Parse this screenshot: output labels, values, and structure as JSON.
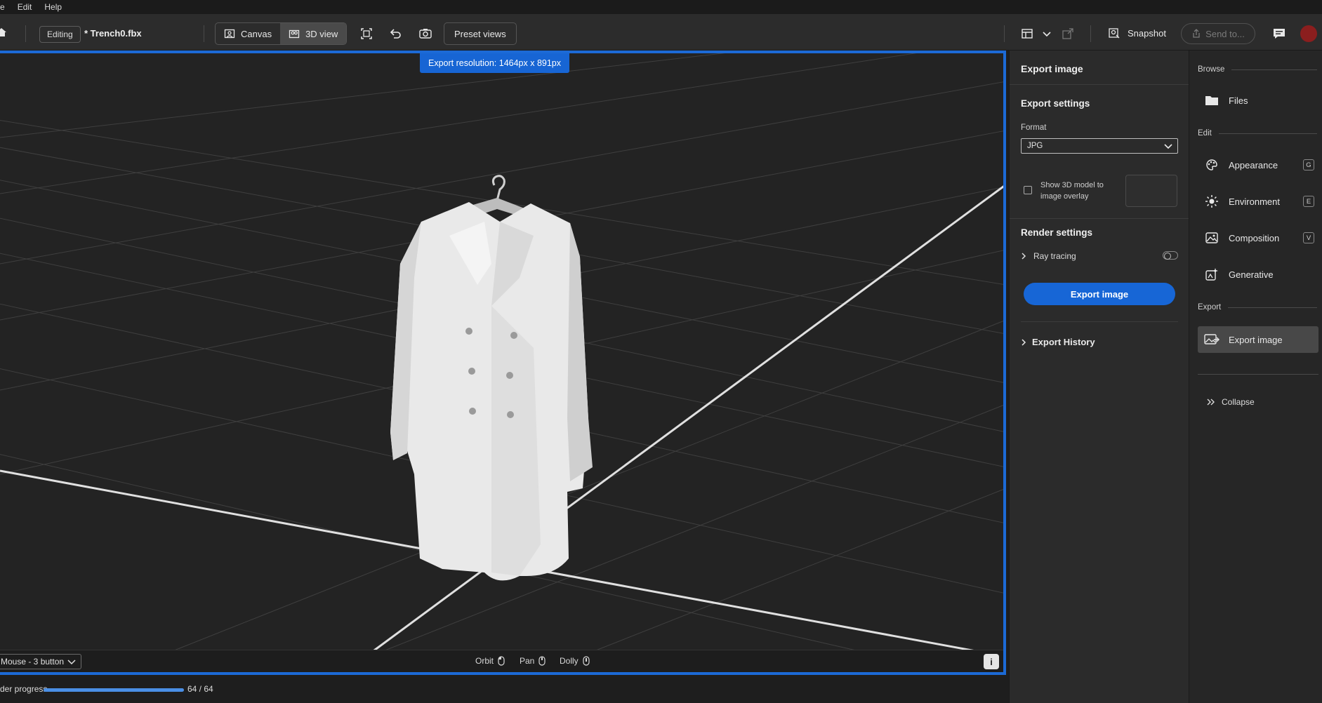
{
  "menu": {
    "items": [
      "e",
      "Edit",
      "Help"
    ]
  },
  "toolbar": {
    "editing_label": "Editing",
    "file_name": "* Trench0.fbx",
    "canvas_label": "Canvas",
    "view3d_label": "3D view",
    "preset_views_label": "Preset views",
    "snapshot_label": "Snapshot",
    "send_to_label": "Send to..."
  },
  "viewport": {
    "export_resolution": "Export resolution: 1464px x 891px",
    "input_mode": "Mouse - 3 button",
    "orbit_label": "Orbit",
    "pan_label": "Pan",
    "dolly_label": "Dolly",
    "info_label": "i"
  },
  "status": {
    "progress_label": "der progress",
    "progress_value": 64,
    "progress_max": 64,
    "progress_text": "64 / 64"
  },
  "export_panel": {
    "title": "Export image",
    "settings_heading": "Export settings",
    "format_label": "Format",
    "format_value": "JPG",
    "overlay_label": "Show 3D model to image overlay",
    "render_heading": "Render settings",
    "ray_tracing_label": "Ray tracing",
    "export_button": "Export image",
    "history_label": "Export History"
  },
  "sidebar": {
    "browse_group": "Browse",
    "files_label": "Files",
    "edit_group": "Edit",
    "appearance_label": "Appearance",
    "appearance_key": "G",
    "environment_label": "Environment",
    "environment_key": "E",
    "composition_label": "Composition",
    "composition_key": "V",
    "generative_label": "Generative",
    "export_group": "Export",
    "export_image_label": "Export image",
    "collapse_label": "Collapse"
  },
  "colors": {
    "accent": "#1766d6",
    "viewport_border": "#1c6ad6",
    "progress_fill": "#4a8fe6"
  }
}
